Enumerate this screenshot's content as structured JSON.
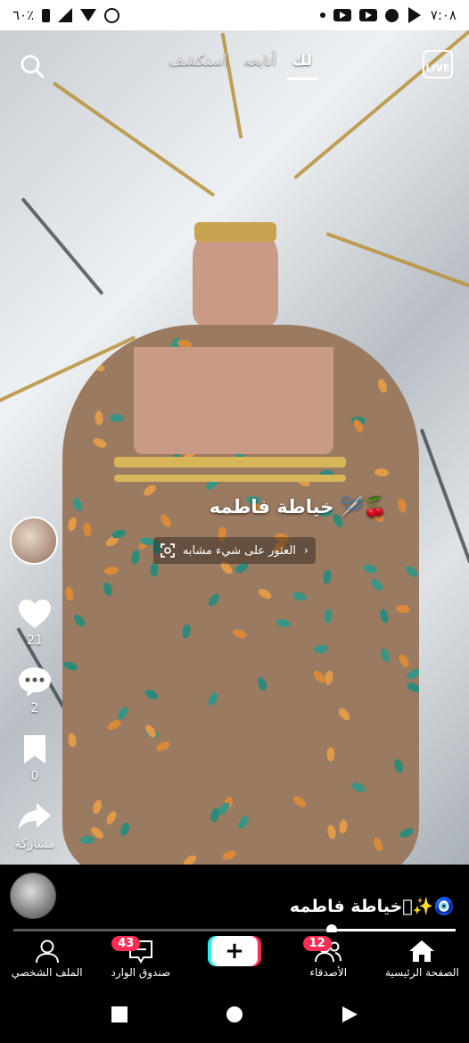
{
  "status_bar": {
    "time": "٧:٠٨",
    "battery": "٦٠٪",
    "left_icons": [
      "battery-icon",
      "signal-icon",
      "wifi-icon",
      "alarm-icon"
    ],
    "right_icons": [
      "dot-icon",
      "youtube-icon",
      "youtube-icon",
      "facebook-icon",
      "telegram-icon"
    ]
  },
  "top_nav": {
    "tabs": [
      {
        "label": "لك",
        "active": true
      },
      {
        "label": "أتابعه",
        "active": false
      },
      {
        "label": "استكشف",
        "active": false
      }
    ],
    "live_label": "LIVE"
  },
  "video": {
    "caption": "خياطة فاطمه 🪡🍒",
    "find_similar": "العثور على شيء مشابه"
  },
  "actions": {
    "likes": "21",
    "comments": "2",
    "saves": "0",
    "share_label": "مشاركة"
  },
  "info": {
    "account_name": "خياطة فاطمه\u0000✨🧿",
    "progress": 0.28
  },
  "tabbar": {
    "home": "الصفحة الرئيسية",
    "friends": "الأصدقاء",
    "friends_badge": "12",
    "create": "+",
    "inbox": "صندوق الوارد",
    "inbox_badge": "43",
    "profile": "الملف الشخصي"
  },
  "colors": {
    "accent_red": "#fe2c55",
    "accent_cyan": "#25f4ee"
  }
}
